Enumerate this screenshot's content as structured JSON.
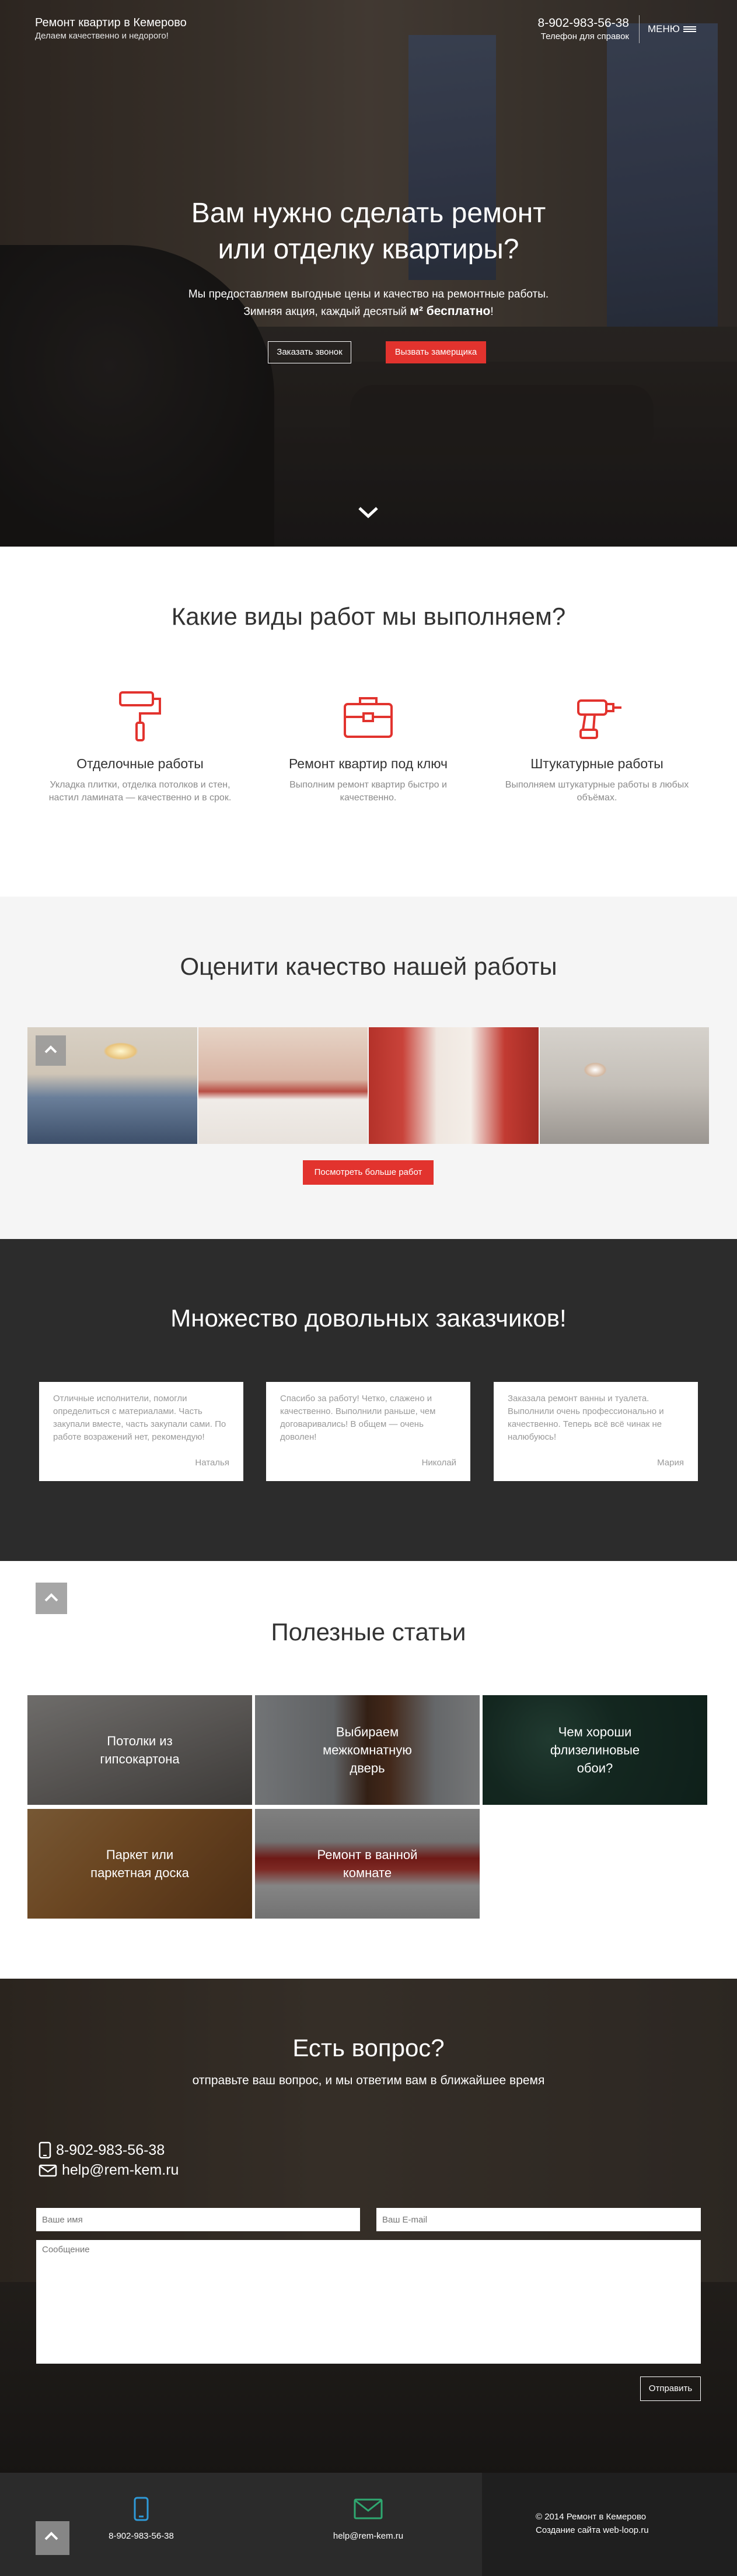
{
  "header": {
    "brand_title": "Ремонт квартир в Кемерово",
    "brand_slogan": "Делаем качественно и недорого!",
    "phone": "8-902-983-56-38",
    "phone_caption": "Телефон для справок",
    "menu_label": "МЕНЮ"
  },
  "hero": {
    "title": "Вам нужно сделать ремонт или отделку квартиры?",
    "lead_line1": "Мы предоставляем выгодные цены и качество на ремонтные работы.",
    "lead_line2_prefix": "Зимняя акция, каждый десятый ",
    "lead_line2_bold": "м² бесплатно",
    "lead_line2_suffix": "!",
    "btn_call": "Заказать звонок",
    "btn_measure": "Вызвать замерщика"
  },
  "services": {
    "title": "Какие виды работ мы выполняем?",
    "items": [
      {
        "icon": "paint-roller-icon",
        "title": "Отделочные работы",
        "text": "Укладка плитки, отделка потолков и стен, настил ламината — качественно и в срок."
      },
      {
        "icon": "toolbox-icon",
        "title": "Ремонт квартир под ключ",
        "text": "Выполним ремонт квартир быстро и качественно."
      },
      {
        "icon": "drill-icon",
        "title": "Штукатурные работы",
        "text": "Выполняем штукатурные работы в любых объёмах."
      }
    ]
  },
  "gallery": {
    "title": "Оценити качество нашей работы",
    "btn_more": "Посмотреть больше работ"
  },
  "reviews": {
    "title": "Множество довольных заказчиков!",
    "items": [
      {
        "text": "Отличные исполнители, помогли определиться с материалами. Часть закупали вместе, часть закупали сами. По работе возражений нет, рекомендую!",
        "author": "Наталья"
      },
      {
        "text": "Спасибо за работу! Четко, слажено и качественно. Выполнили раньше, чем договаривались! В общем — очень доволен!",
        "author": "Николай"
      },
      {
        "text": "Заказала ремонт ванны и туалета. Выполнили очень профессионально и качественно. Теперь всё всё чинак не налюбуюсь!",
        "author": "Мария"
      }
    ]
  },
  "articles": {
    "title": "Полезные статьи",
    "items": [
      {
        "label": "Потолки из гипсокартона"
      },
      {
        "label": "Выбираем межкомнатную дверь"
      },
      {
        "label": "Чем хороши флизелиновые обои?"
      },
      {
        "label": "Паркет или паркетная доска"
      },
      {
        "label": "Ремонт в ванной комнате"
      }
    ]
  },
  "contact": {
    "title": "Есть вопрос?",
    "subtitle": "отправьте ваш вопрос, и мы ответим вам в ближайшее время",
    "phone": "8-902-983-56-38",
    "email": "help@rem-kem.ru",
    "name_placeholder": "Ваше имя",
    "email_placeholder": "Ваш E-mail",
    "message_placeholder": "Сообщение",
    "send_label": "Отправить"
  },
  "footer": {
    "phone": "8-902-983-56-38",
    "email": "help@rem-kem.ru",
    "copyright": "© 2014 Ремонт в Кемерово",
    "credits": "Создание сайта web-loop.ru"
  },
  "colors": {
    "accent": "#e2332e",
    "dark_section": "#2c2c2c",
    "footer_icon": "#2f9ad8"
  }
}
